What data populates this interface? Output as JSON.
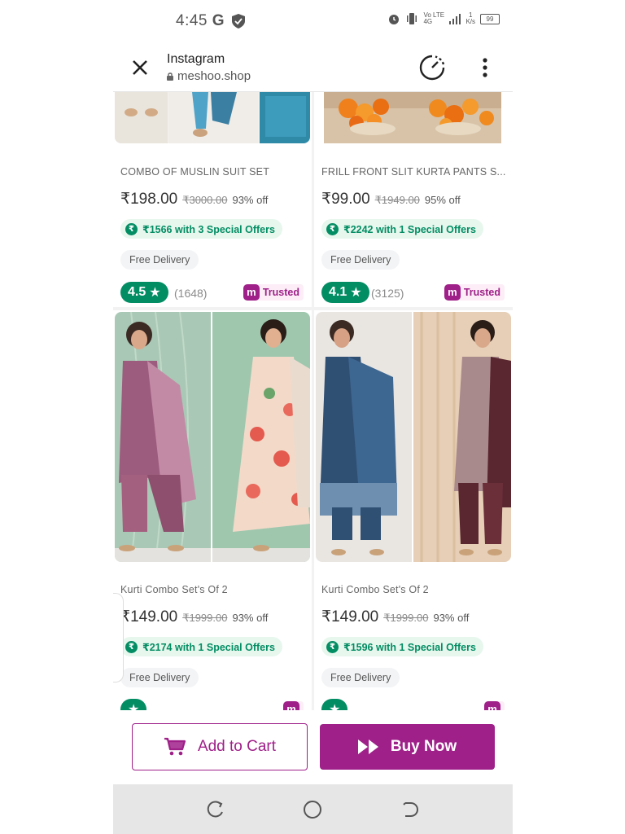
{
  "status_bar": {
    "time": "4:45",
    "g_label": "G",
    "network_label": "Vo LTE 4G",
    "speed_top": "1",
    "speed_unit": "K/s",
    "battery": "99"
  },
  "browser": {
    "title": "Instagram",
    "url": "meshoo.shop"
  },
  "products": [
    {
      "name": "COMBO OF MUSLIN SUIT SET",
      "price": "₹198.00",
      "mrp": "₹3000.00",
      "discount": "93% off",
      "offer": "₹1566 with 3 Special Offers",
      "delivery": "Free Delivery",
      "rating": "4.5",
      "reviews": "(1648)",
      "trusted": "Trusted"
    },
    {
      "name": "FRILL FRONT SLIT KURTA PANTS S...",
      "price": "₹99.00",
      "mrp": "₹1949.00",
      "discount": "95% off",
      "offer": "₹2242 with 1 Special Offers",
      "delivery": "Free Delivery",
      "rating": "4.1",
      "reviews": "(3125)",
      "trusted": "Trusted"
    },
    {
      "name": "Kurti Combo Set's Of 2",
      "price": "₹149.00",
      "mrp": "₹1999.00",
      "discount": "93% off",
      "offer": "₹2174 with 1 Special Offers",
      "delivery": "Free Delivery"
    },
    {
      "name": "Kurti Combo Set's Of 2",
      "price": "₹149.00",
      "mrp": "₹1999.00",
      "discount": "93% off",
      "offer": "₹1596 with 1 Special Offers",
      "delivery": "Free Delivery"
    }
  ],
  "actions": {
    "add_to_cart": "Add to Cart",
    "buy_now": "Buy Now"
  },
  "colors": {
    "brand": "#9f2089",
    "green": "#038d63"
  }
}
